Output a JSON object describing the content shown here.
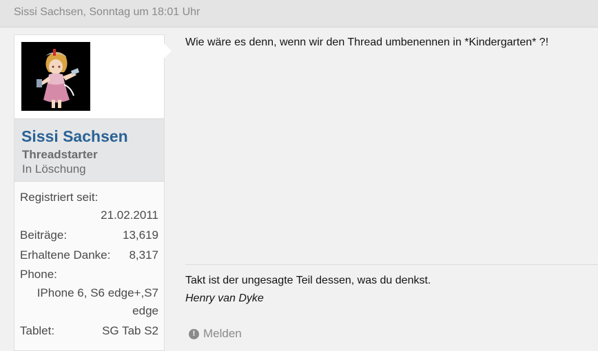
{
  "post": {
    "header": "Sissi Sachsen, Sonntag um 18:01 Uhr",
    "message": "Wie wäre es denn, wenn wir den Thread umbenennen in *Kindergarten* ?!",
    "signature": {
      "quote": "Takt ist der ungesagte Teil dessen, was du denkst.",
      "author": "Henry van Dyke"
    },
    "report_label": "Melden",
    "report_icon": "exclamation-circle-icon"
  },
  "user": {
    "name": "Sissi Sachsen",
    "title": "Threadstarter",
    "status": "In Löschung",
    "registered_label": "Registriert seit:",
    "registered_value": "21.02.2011",
    "posts_label": "Beiträge:",
    "posts_value": "13,619",
    "thanks_label": "Erhaltene Danke:",
    "thanks_value": "8,317",
    "phone_label": "Phone:",
    "phone_value_line1": "IPhone 6, S6 edge+,S7",
    "phone_value_line2": "edge",
    "tablet_label": "Tablet:",
    "tablet_value": "SG Tab S2"
  },
  "colors": {
    "username": "#2a6295",
    "header_bg": "#e4e4e4",
    "muted_text": "#8a8a8a"
  }
}
